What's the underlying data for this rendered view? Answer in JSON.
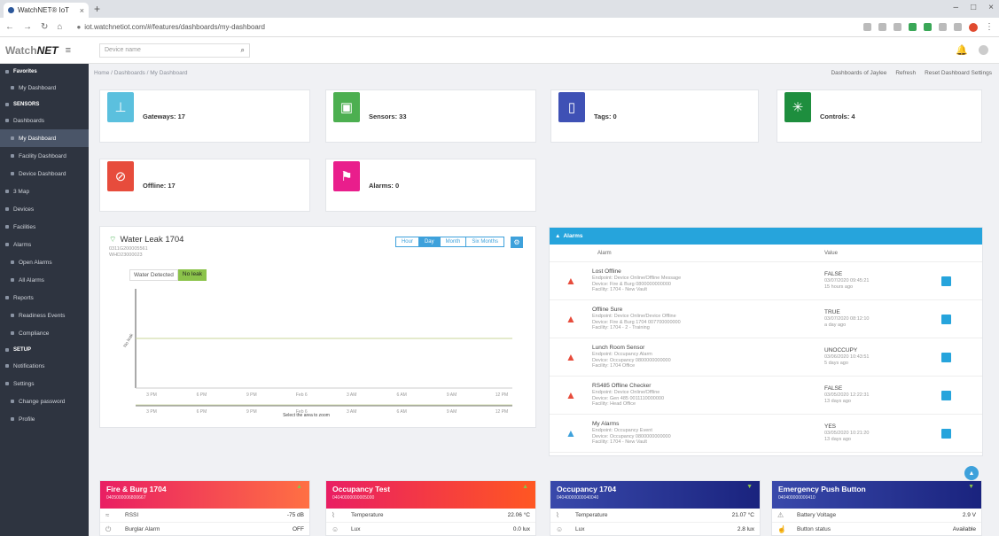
{
  "browser": {
    "tab_title": "WatchNET® IoT",
    "url": "iot.watchnetiot.com/#/features/dashboards/my-dashboard"
  },
  "header": {
    "logo_prefix": "Watch",
    "logo_suffix": "NET",
    "search_placeholder": "Device name"
  },
  "sidebar": {
    "items": [
      {
        "label": "Favorites",
        "kind": "sec"
      },
      {
        "label": "My Dashboard",
        "kind": "sub"
      },
      {
        "label": "SENSORS",
        "kind": "sec"
      },
      {
        "label": "Dashboards",
        "kind": "item"
      },
      {
        "label": "My Dashboard",
        "kind": "active"
      },
      {
        "label": "Facility Dashboard",
        "kind": "sub"
      },
      {
        "label": "Device Dashboard",
        "kind": "sub"
      },
      {
        "label": "3 Map",
        "kind": "item"
      },
      {
        "label": "Devices",
        "kind": "item"
      },
      {
        "label": "Facilities",
        "kind": "item"
      },
      {
        "label": "Alarms",
        "kind": "item"
      },
      {
        "label": "Open Alarms",
        "kind": "sub"
      },
      {
        "label": "All Alarms",
        "kind": "sub"
      },
      {
        "label": "Reports",
        "kind": "item"
      },
      {
        "label": "Readiness Events",
        "kind": "sub"
      },
      {
        "label": "Compliance",
        "kind": "sub"
      },
      {
        "label": "SETUP",
        "kind": "sec"
      },
      {
        "label": "Notifications",
        "kind": "item"
      },
      {
        "label": "Settings",
        "kind": "item"
      },
      {
        "label": "Change password",
        "kind": "sub"
      },
      {
        "label": "Profile",
        "kind": "sub"
      }
    ]
  },
  "breadcrumb": "Home / Dashboards / My Dashboard",
  "top_actions": [
    "Dashboards of Jaylee",
    "Refresh",
    "Reset Dashboard Settings"
  ],
  "stats": [
    {
      "label": "Gateways: 17",
      "color": "#5bc0de",
      "icon": "gateway-icon",
      "glyph": "⊥"
    },
    {
      "label": "Sensors: 33",
      "color": "#4caf50",
      "icon": "sensor-icon",
      "glyph": "▣"
    },
    {
      "label": "Tags: 0",
      "color": "#3f51b5",
      "icon": "tag-icon",
      "glyph": "▯"
    },
    {
      "label": "Controls: 4",
      "color": "#1e8e3e",
      "icon": "controls-icon",
      "glyph": "✳"
    },
    {
      "label": "Offline: 17",
      "color": "#e74c3c",
      "icon": "offline-icon",
      "glyph": "⊘"
    },
    {
      "label": "Alarms: 0",
      "color": "#e91e8c",
      "icon": "alarm-siren-icon",
      "glyph": "⚑"
    }
  ],
  "leak": {
    "title": "Water Leak 1704",
    "sub1": "0311G200005561",
    "sub2": "WHD23000023",
    "ranges": [
      "Hour",
      "Day",
      "Month",
      "Six Months"
    ],
    "active_range": "Day",
    "legend_key": "Water Detected",
    "legend_value": "No leak",
    "y_label": "No leak",
    "x_ticks": [
      "3 PM",
      "6 PM",
      "9 PM",
      "Feb 6",
      "3 AM",
      "6 AM",
      "9 AM",
      "12 PM"
    ],
    "nav_caption": "Select the area to zoom",
    "level": 0.5
  },
  "alarms": {
    "title": "Alarms",
    "col_alarm": "Alarm",
    "col_value": "Value",
    "rows": [
      {
        "title": "Lost Offline",
        "l1": "Endpoint: Device Online/Offline Message",
        "l2": "Device: Fire & Burg 0800000000000",
        "l3": "Facility: 1704 - New Vault",
        "val": "FALSE",
        "t": "03/07/2020 09:45:21",
        "ago": "15 hours ago",
        "color": "#e74c3c"
      },
      {
        "title": "Offline Sure",
        "l1": "Endpoint: Device Online/Device Offline",
        "l2": "Device: Fire & Burg 1704 007700000000",
        "l3": "Facility: 1704 - 2 - Training",
        "val": "TRUE",
        "t": "03/07/2020 08:12:10",
        "ago": "a day ago",
        "color": "#e74c3c"
      },
      {
        "title": "Lunch Room Sensor",
        "l1": "Endpoint: Occupancy Alarm",
        "l2": "Device: Occupancy 0800000000000",
        "l3": "Facility: 1704 Office",
        "val": "UNOCCUPY",
        "t": "03/06/2020 10:43:51",
        "ago": "5 days ago",
        "color": "#e74c3c"
      },
      {
        "title": "RS485 Offline Checker",
        "l1": "Endpoint: Device Online/Offline",
        "l2": "Device: Gen 485 0011110000000",
        "l3": "Facility: Head Office",
        "val": "FALSE",
        "t": "03/05/2020 12:22:31",
        "ago": "13 days ago",
        "color": "#e74c3c"
      },
      {
        "title": "My Alarms",
        "l1": "Endpoint: Occupancy Event",
        "l2": "Device: Occupancy 0800000000000",
        "l3": "Facility: 1704 - New Vault",
        "val": "YES",
        "t": "03/05/2020 10:21:20",
        "ago": "13 days ago",
        "color": "#3ea1db"
      }
    ]
  },
  "devices": [
    {
      "name": "Fire & Burg 1704",
      "sub": "0405000006800667",
      "grad": "linear-gradient(90deg,#e91e63,#ff7043)",
      "ind": "▲",
      "ind_color": "#8bc34a",
      "rows": [
        {
          "icon": "wifi-icon",
          "glyph": "≈",
          "label": "RSSI",
          "value": "-75 dB"
        },
        {
          "icon": "power-icon",
          "glyph": "⏻",
          "label": "Burglar Alarm",
          "value": "OFF"
        }
      ]
    },
    {
      "name": "Occupancy Test",
      "sub": "04040000000005000",
      "grad": "linear-gradient(90deg,#e91e63,#ff5722)",
      "ind": "▲",
      "ind_color": "#8bc34a",
      "rows": [
        {
          "icon": "thermometer-icon",
          "glyph": "⌇",
          "label": "Temperature",
          "value": "22.06 °C"
        },
        {
          "icon": "person-icon",
          "glyph": "☺",
          "label": "Lux",
          "value": "0.0 lux"
        }
      ]
    },
    {
      "name": "Occupancy 1704",
      "sub": "04040000000040040",
      "grad": "linear-gradient(90deg,#3949ab,#1a237e)",
      "ind": "▼",
      "ind_color": "#8bc34a",
      "rows": [
        {
          "icon": "thermometer-icon",
          "glyph": "⌇",
          "label": "Temperature",
          "value": "21.07 °C"
        },
        {
          "icon": "person-icon",
          "glyph": "☺",
          "label": "Lux",
          "value": "2.8 lux"
        }
      ]
    },
    {
      "name": "Emergency Push Button",
      "sub": "040400000000410",
      "grad": "linear-gradient(90deg,#3949ab,#1a237e)",
      "ind": "▼",
      "ind_color": "#8bc34a",
      "rows": [
        {
          "icon": "warning-icon",
          "glyph": "⚠",
          "label": "Battery Voltage",
          "value": "2.9 V"
        },
        {
          "icon": "button-icon",
          "glyph": "☝",
          "label": "Button status",
          "value": "Available"
        }
      ]
    }
  ]
}
